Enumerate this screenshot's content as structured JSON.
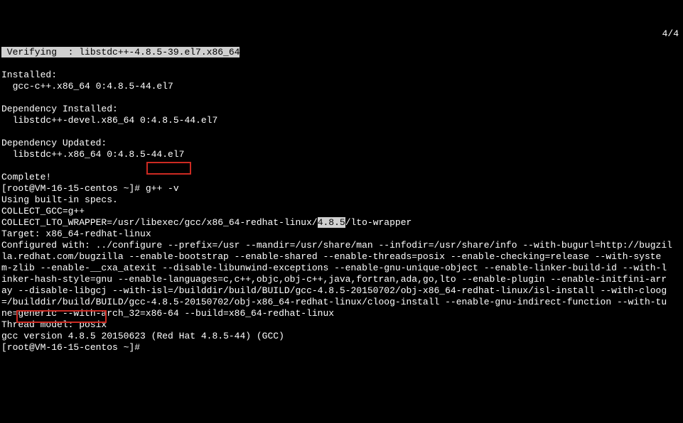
{
  "top": {
    "verifying": " Verifying  : libstdc++-4.8.5-39.el7.x86_64",
    "counter": "4/4"
  },
  "installed": {
    "header": "Installed:",
    "line": "  gcc-c++.x86_64 0:4.8.5-44.el7"
  },
  "depInstalled": {
    "header": "Dependency Installed:",
    "line": "  libstdc++-devel.x86_64 0:4.8.5-44.el7"
  },
  "depUpdated": {
    "header": "Dependency Updated:",
    "line": "  libstdc++.x86_64 0:4.8.5-44.el7"
  },
  "complete": "Complete!",
  "prompt1": {
    "pre": "[root@VM-16-15-centos ~]#",
    "cmd": " g++ -v"
  },
  "specs": "Using built-in specs.",
  "collectGcc": "COLLECT_GCC=g++",
  "wrapper": {
    "pre": "COLLECT_LTO_WRAPPER=/usr/libexec/gcc/x86_64-redhat-linux/",
    "ver": "4.8.5",
    "post": "/lto-wrapper"
  },
  "target": "Target: x86_64-redhat-linux",
  "conf1": "Configured with: ../configure --prefix=/usr --mandir=/usr/share/man --infodir=/usr/share/info --with-bugurl=http://bugzil",
  "conf2": "la.redhat.com/bugzilla --enable-bootstrap --enable-shared --enable-threads=posix --enable-checking=release --with-syste",
  "conf3": "m-zlib --enable-__cxa_atexit --disable-libunwind-exceptions --enable-gnu-unique-object --enable-linker-build-id --with-l",
  "conf4": "inker-hash-style=gnu --enable-languages=c,c++,objc,obj-c++,java,fortran,ada,go,lto --enable-plugin --enable-initfini-arr",
  "conf5": "ay --disable-libgcj --with-isl=/builddir/build/BUILD/gcc-4.8.5-20150702/obj-x86_64-redhat-linux/isl-install --with-cloog",
  "conf6": "=/builddir/build/BUILD/gcc-4.8.5-20150702/obj-x86_64-redhat-linux/cloog-install --enable-gnu-indirect-function --with-tu",
  "conf7": "ne=generic --with-arch_32=x86-64 --build=x86_64-redhat-linux",
  "thread": "Thread model: posix",
  "gccver": {
    "pre": "gcc",
    "mid": " version 4.8.5 ",
    "post": "20150623 (Red Hat 4.8.5-44) (GCC)"
  },
  "prompt2": "[root@VM-16-15-centos ~]#"
}
